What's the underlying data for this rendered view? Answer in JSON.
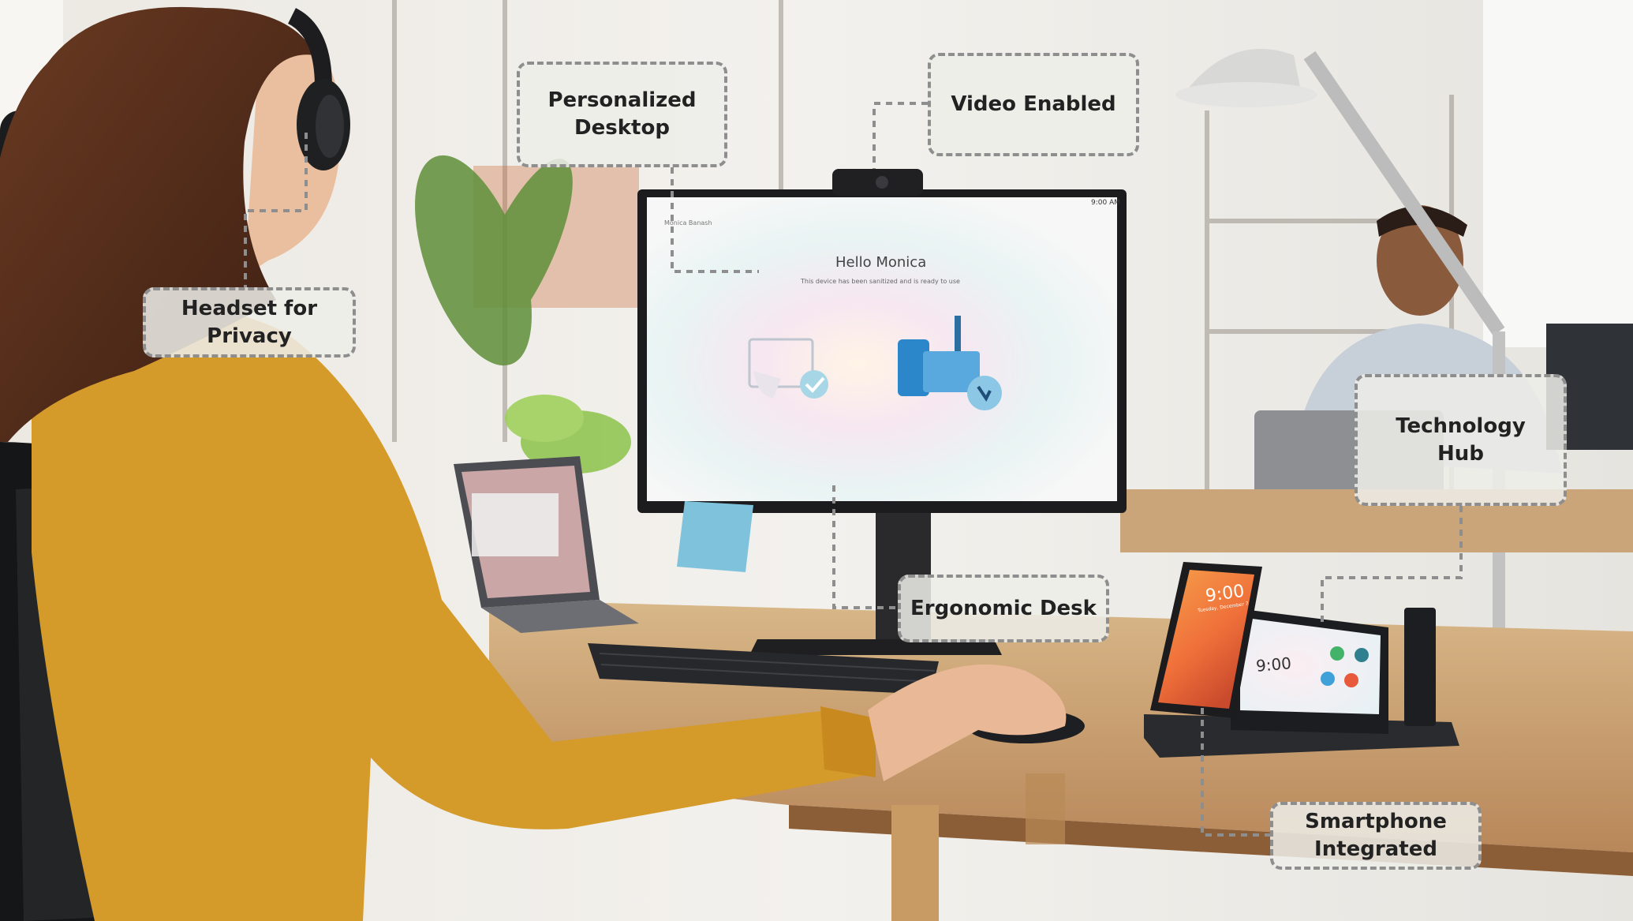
{
  "callouts": {
    "personalized_desktop": "Personalized\nDesktop",
    "video_enabled": "Video Enabled",
    "headset_privacy": "Headset for\nPrivacy",
    "technology_hub": "Technology\nHub",
    "ergonomic_desk": "Ergonomic Desk",
    "smartphone_integrated": "Smartphone\nIntegrated"
  },
  "monitor": {
    "time": "9:00 AM",
    "user": "Monica Banash",
    "greeting": "Hello Monica",
    "status": "This device has been sanitized and is ready to use"
  },
  "phone": {
    "time": "9:00",
    "date": "Tuesday, December 7"
  },
  "hub": {
    "time": "9:00"
  },
  "colors": {
    "sweater": "#d49a2a",
    "desk": "#c49a67",
    "sticky_note": "#7fc2dc",
    "phone_screen": "#f07a3a",
    "callout_border": "#8e8e8e",
    "callout_fill": "#eeede9"
  }
}
